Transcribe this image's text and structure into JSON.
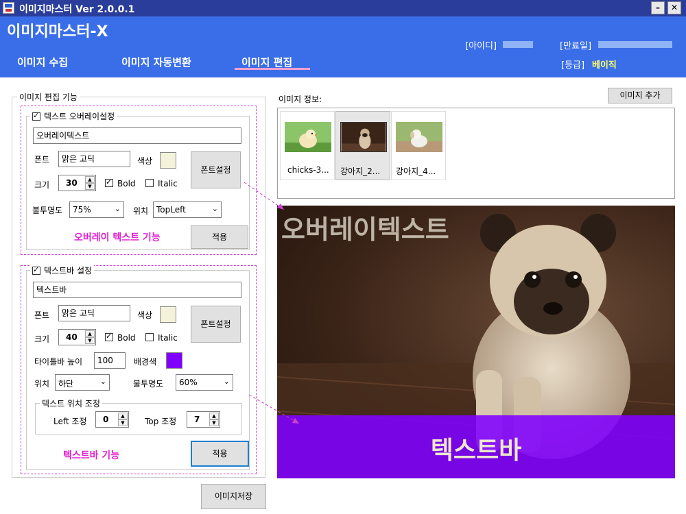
{
  "window": {
    "title": "이미지마스터   Ver 2.0.0.1",
    "minimize": "–",
    "close": "✕"
  },
  "header": {
    "brand": "이미지마스터-X",
    "tabs": [
      {
        "label": "이미지 수집",
        "active": false
      },
      {
        "label": "이미지 자동변환",
        "active": false
      },
      {
        "label": "이미지 편집",
        "active": true
      }
    ],
    "id_label": "[아이디]",
    "expiry_label": "[만료일]",
    "grade_label": "[등급]",
    "grade_value": "베이직"
  },
  "edit": {
    "group_title": "이미지 편집 기능",
    "overlay": {
      "checkbox_label": "텍스트 오버레이설정",
      "enabled": true,
      "text_value": "오버레이텍스트",
      "font_label": "폰트",
      "font_value": "맑은 고딕",
      "color_label": "색상",
      "color": "#f5f2dc",
      "font_button": "폰트설정",
      "size_label": "크기",
      "size_value": "30",
      "bold_label": "Bold",
      "bold": true,
      "italic_label": "Italic",
      "italic": false,
      "opacity_label": "불투명도",
      "opacity_value": "75%",
      "position_label": "위치",
      "position_value": "TopLeft",
      "feature_caption": "오버레이 텍스트 기능",
      "apply_button": "적용"
    },
    "textbar": {
      "checkbox_label": "텍스트바 설정",
      "enabled": true,
      "text_value": "텍스트바",
      "font_label": "폰트",
      "font_value": "맑은 고딕",
      "color_label": "색상",
      "color": "#f5f2dc",
      "font_button": "폰트설정",
      "size_label": "크기",
      "size_value": "40",
      "bold_label": "Bold",
      "bold": true,
      "italic_label": "Italic",
      "italic": false,
      "titlebar_height_label": "타이틀바 높이",
      "titlebar_height_value": "100",
      "bg_color_label": "배경색",
      "bg_color": "#8000ff",
      "position_label": "위치",
      "position_value": "하단",
      "opacity_label": "불투명도",
      "opacity_value": "60%",
      "adjust_group_title": "텍스트 위치 조정",
      "left_label": "Left 조정",
      "left_value": "0",
      "top_label": "Top 조정",
      "top_value": "7",
      "feature_caption": "텍스트바 기능",
      "apply_button": "적용"
    },
    "save_button": "이미지저장"
  },
  "images": {
    "info_label": "이미지 정보:",
    "add_button": "이미지 추가",
    "thumbnails": [
      {
        "label": "chicks-3...",
        "selected": false
      },
      {
        "label": "강아지_2...",
        "selected": true
      },
      {
        "label": "강아지_4...",
        "selected": false
      }
    ]
  },
  "preview": {
    "overlay_text": "오버레이텍스트",
    "textbar_text": "텍스트바",
    "textbar_color": "#8000ff"
  },
  "colors": {
    "titlebar": "#2a3d9a",
    "header": "#3a6ee8",
    "accent_magenta": "#e020d0",
    "grade": "#ffff66"
  }
}
